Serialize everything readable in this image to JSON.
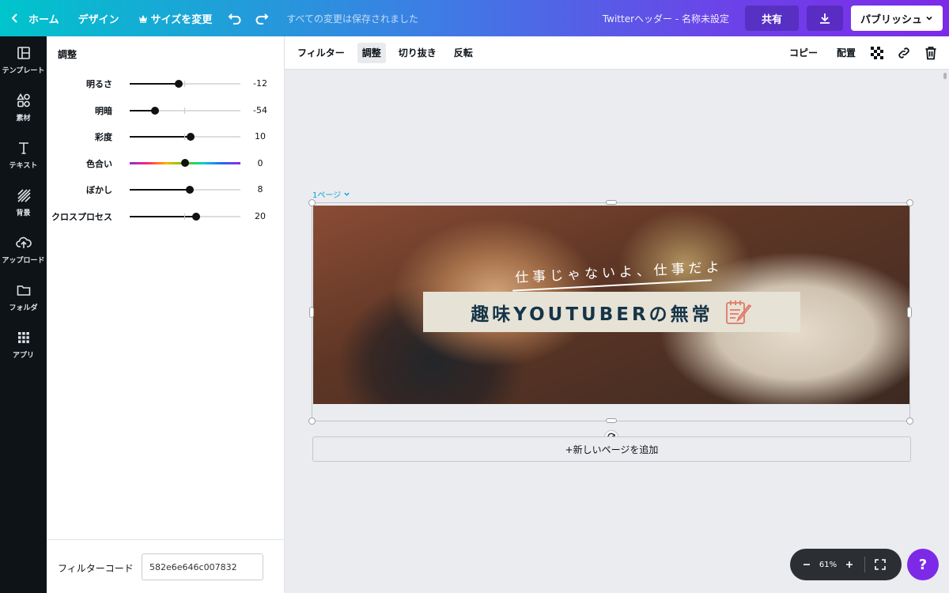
{
  "topbar": {
    "home": "ホーム",
    "design": "デザイン",
    "resize": "サイズを変更",
    "saved_status": "すべての変更は保存されました",
    "doc_title": "Twitterヘッダー - 名称未設定",
    "share": "共有",
    "publish": "パブリッシュ"
  },
  "rail": {
    "templates": "テンプレート",
    "elements": "素材",
    "text": "テキスト",
    "background": "背景",
    "upload": "アップロード",
    "folder": "フォルダ",
    "apps": "アプリ"
  },
  "panel": {
    "title": "調整",
    "sliders": [
      {
        "label": "明るさ",
        "value": "-12",
        "fraction": 0.44
      },
      {
        "label": "明暗",
        "value": "-54",
        "fraction": 0.23
      },
      {
        "label": "彩度",
        "value": "10",
        "fraction": 0.55
      },
      {
        "label": "色合い",
        "value": "0",
        "fraction": 0.5
      },
      {
        "label": "ぼかし",
        "value": "8",
        "fraction": 0.54
      },
      {
        "label": "クロスプロセス",
        "value": "20",
        "fraction": 0.6
      }
    ],
    "filter_code_label": "フィルターコード",
    "filter_code_value": "582e6e646c007832"
  },
  "toolbar": {
    "filter": "フィルター",
    "adjust": "調整",
    "crop": "切り抜き",
    "flip": "反転",
    "copy": "コピー",
    "arrange": "配置"
  },
  "canvas": {
    "page_label": "1ページ",
    "subtitle": "仕事じゃないよ、仕事だよ",
    "title": "趣味YOUTUBERの無常",
    "add_page": "+新しいページを追加"
  },
  "zoom": {
    "value": "61%"
  },
  "help": "?",
  "colors": {
    "accent": "#7d2ae8",
    "teal": "#00c4cc",
    "title_box": "#e7e2d6",
    "title_text": "#153548"
  }
}
